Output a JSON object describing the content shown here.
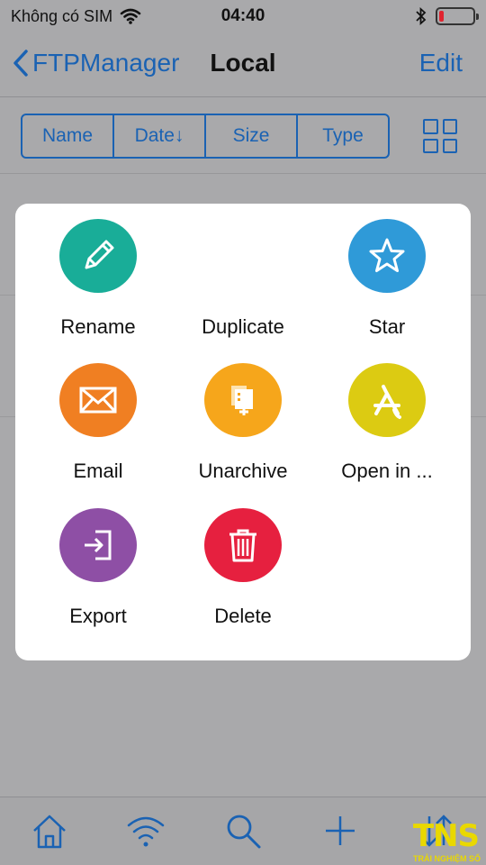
{
  "status_bar": {
    "carrier": "Không có SIM",
    "time": "04:40",
    "battery_level": 0.15,
    "battery_color": "#e0242f"
  },
  "nav": {
    "back_label": "FTPManager",
    "title": "Local",
    "edit_label": "Edit"
  },
  "sort": {
    "options": [
      "Name",
      "Date↓",
      "Size",
      "Type"
    ]
  },
  "actions": [
    {
      "label": "Rename",
      "icon": "pencil-icon",
      "color": "#19ad98"
    },
    {
      "label": "Duplicate",
      "icon": "",
      "color": ""
    },
    {
      "label": "Star",
      "icon": "star-icon",
      "color": "#2f9ad8"
    },
    {
      "label": "Email",
      "icon": "envelope-icon",
      "color": "#f07f22"
    },
    {
      "label": "Unarchive",
      "icon": "unarchive-icon",
      "color": "#f6a61b"
    },
    {
      "label": "Open in ...",
      "icon": "app-store-icon",
      "color": "#dccb12"
    },
    {
      "label": "Export",
      "icon": "export-icon",
      "color": "#8e4fa5"
    },
    {
      "label": "Delete",
      "icon": "trash-icon",
      "color": "#e6203f"
    }
  ],
  "tabs": [
    "home-icon",
    "wifi-icon",
    "search-icon",
    "plus-icon",
    "sort-icon"
  ],
  "accent_color": "#1a62b3",
  "watermark": {
    "logo": "TNS",
    "text": "TRẢI NGHIỆM SỐ"
  }
}
